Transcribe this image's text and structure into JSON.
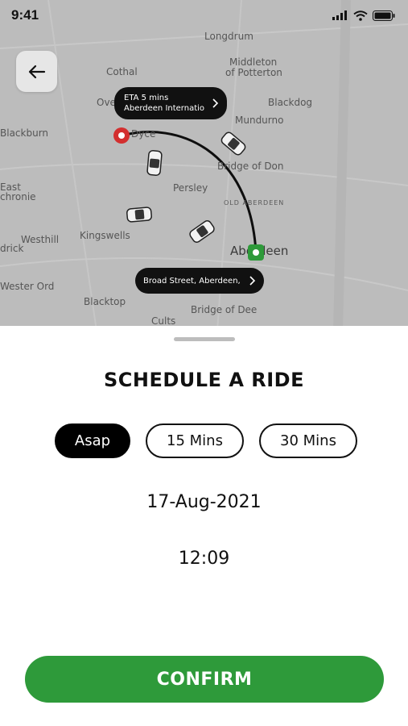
{
  "status_bar": {
    "time": "9:41",
    "icons": [
      "cellular-signal-icon",
      "wifi-icon",
      "battery-icon"
    ]
  },
  "map": {
    "places": [
      "Longdrum",
      "Middleton",
      "of Potterton",
      "Cothal",
      "Blackdog",
      "Over",
      "Mundurno",
      "Blackburn",
      "Dyce",
      "Bridge of Don",
      "Persley",
      "East",
      "chronie",
      "OLD ABERDEEN",
      "Westhill",
      "Kingswells",
      "drick",
      "Aberdeen",
      "Wester Ord",
      "Blacktop",
      "Bridge of Dee",
      "Cults"
    ],
    "eta_callout": {
      "line1": "ETA 5 mins",
      "line2": "Aberdeen Internatio"
    },
    "destination_callout": {
      "label": "Broad Street, Aberdeen,"
    },
    "colors": {
      "origin": "#d32f2f",
      "destination": "#2e9a3a",
      "route": "#111111"
    }
  },
  "sheet": {
    "title": "SCHEDULE A RIDE",
    "options": [
      {
        "label": "Asap",
        "selected": true
      },
      {
        "label": "15 Mins",
        "selected": false
      },
      {
        "label": "30 Mins",
        "selected": false
      }
    ],
    "date": "17-Aug-2021",
    "time": "12:09",
    "confirm_label": "CONFIRM"
  },
  "colors": {
    "accent": "#2e9a3a",
    "selected_chip": "#000000"
  }
}
